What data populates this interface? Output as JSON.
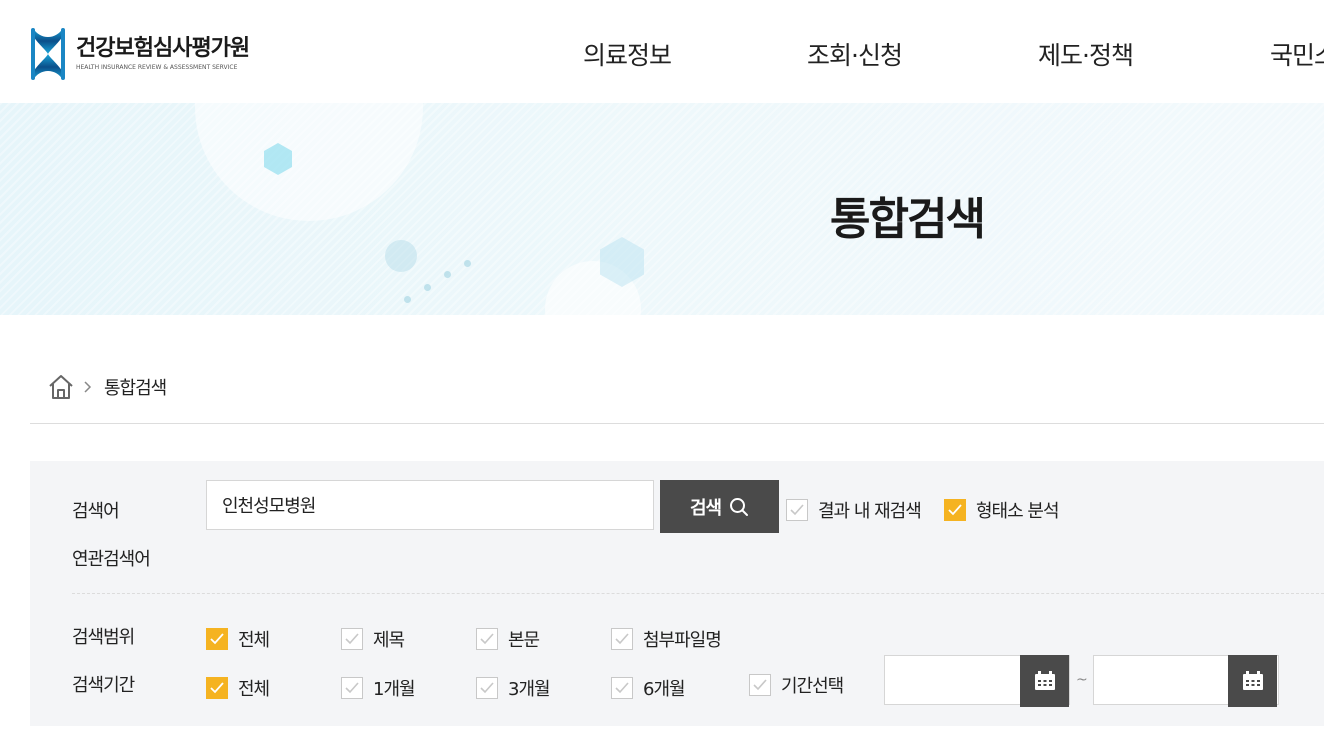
{
  "logo": {
    "name_ko": "건강보험심사평가원",
    "name_en": "HEALTH INSURANCE REVIEW & ASSESSMENT SERVICE"
  },
  "nav": [
    {
      "label": "의료정보"
    },
    {
      "label": "조회·신청"
    },
    {
      "label": "제도·정책"
    },
    {
      "label": "국민소"
    }
  ],
  "banner": {
    "title": "통합검색"
  },
  "breadcrumb": {
    "current": "통합검색"
  },
  "search": {
    "keyword_label": "검색어",
    "keyword_value": "인천성모병원",
    "button_label": "검색",
    "options": [
      {
        "label": "결과 내 재검색",
        "checked": false
      },
      {
        "label": "형태소 분석",
        "checked": true
      }
    ],
    "related_label": "연관검색어",
    "scope_label": "검색범위",
    "scope_options": [
      {
        "label": "전체",
        "checked": true
      },
      {
        "label": "제목",
        "checked": false
      },
      {
        "label": "본문",
        "checked": false
      },
      {
        "label": "첨부파일명",
        "checked": false
      }
    ],
    "period_label": "검색기간",
    "period_options": [
      {
        "label": "전체",
        "checked": true
      },
      {
        "label": "1개월",
        "checked": false
      },
      {
        "label": "3개월",
        "checked": false
      },
      {
        "label": "6개월",
        "checked": false
      },
      {
        "label": "기간선택",
        "checked": false
      }
    ],
    "date_separator": "~"
  },
  "colors": {
    "accent_check": "#f5b321",
    "button_dark": "#4a4a4a",
    "panel_bg": "#f4f5f7"
  }
}
